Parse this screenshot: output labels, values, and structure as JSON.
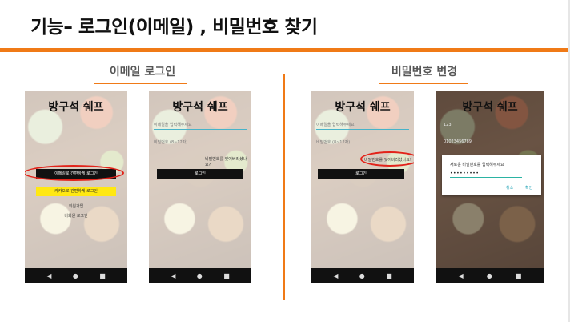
{
  "slide": {
    "title": "기능– 로그인(이메일) , 비밀번호 찾기",
    "accent_color": "#f07a17",
    "highlight_color": "#e2231a"
  },
  "sections": {
    "email_login": "이메일 로그인",
    "password_change": "비밀번호 변경"
  },
  "app_title": "방구석 쉐프",
  "screen1": {
    "email_button": "이메일로 간편하게 로그인",
    "kakao_button": "카카오로 간편하게 로그인",
    "signup": "회원가입",
    "non_member_login": "비회원 로그인"
  },
  "screen2": {
    "email_placeholder": "이메일을 입력해주세요",
    "password_placeholder": "비밀번호 (8~12자)",
    "forgot_password": "비밀번호를 잊어버리셨나요?",
    "login_button": "로그인"
  },
  "screen3": {
    "email_placeholder": "이메일을 입력해주세요",
    "password_placeholder": "비밀번호 (8~12자)",
    "forgot_password": "비밀번호를 잊어버리셨나요?",
    "login_button": "로그인"
  },
  "screen4": {
    "email_value": "123",
    "password_value": "01023456789",
    "dialog_title": "새로운 비밀번호를 입력해주세요",
    "dialog_value": "•••••••••",
    "cancel": "취소",
    "confirm": "확인"
  },
  "navbar": {
    "back": "◀",
    "home": "●",
    "recent": "■"
  }
}
